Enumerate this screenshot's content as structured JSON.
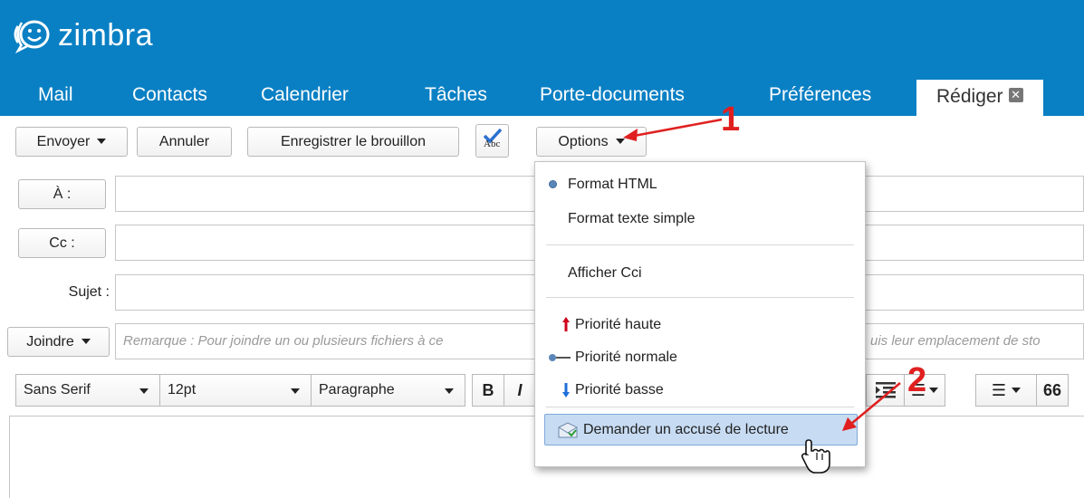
{
  "brand": {
    "logo_text": "zimbra"
  },
  "tabs": [
    {
      "label": "Mail"
    },
    {
      "label": "Contacts"
    },
    {
      "label": "Calendrier"
    },
    {
      "label": "Tâches"
    },
    {
      "label": "Porte-documents"
    },
    {
      "label": "Préférences"
    },
    {
      "label": "Rédiger",
      "active": true,
      "close_glyph": "✕"
    }
  ],
  "toolbar": {
    "send": "Envoyer",
    "cancel": "Annuler",
    "save_draft": "Enregistrer le brouillon",
    "spell_label": "Abc",
    "options": "Options"
  },
  "compose": {
    "to_label": "À :",
    "cc_label": "Cc :",
    "subject_label": "Sujet :",
    "attach_label": "Joindre",
    "attach_hint_left": "Remarque : Pour joindre un ou plusieurs fichiers à ce",
    "attach_hint_right": "uis leur emplacement de sto"
  },
  "format_bar": {
    "font": "Sans Serif",
    "size": "12pt",
    "block": "Paragraphe",
    "bold": "B",
    "italic": "I",
    "quote": "66"
  },
  "options_menu": {
    "items": [
      {
        "label": "Format HTML",
        "icon": "selected-dot-icon",
        "selected": true
      },
      {
        "label": "Format texte simple"
      },
      {
        "label": "Afficher Cci"
      },
      {
        "label": "Priorité haute",
        "icon": "priority-high-arrow-icon"
      },
      {
        "label": "Priorité normale",
        "icon": "priority-normal-icon"
      },
      {
        "label": "Priorité basse",
        "icon": "priority-low-arrow-icon"
      },
      {
        "label": "Demander un accusé de lecture",
        "icon": "read-receipt-envelope-icon",
        "highlighted": true
      }
    ]
  },
  "annotations": {
    "step1": "1",
    "step2": "2"
  },
  "colors": {
    "header_blue": "#0a80c4",
    "menu_highlight": "#c7dcf3",
    "arrow_red": "#e02020",
    "priority_high": "#d0021b",
    "priority_low": "#1e6fd9"
  },
  "icons": [
    "zimbra-logo-icon",
    "close-icon",
    "spellcheck-icon",
    "chevron-down-icon",
    "cursor-hand-icon"
  ]
}
